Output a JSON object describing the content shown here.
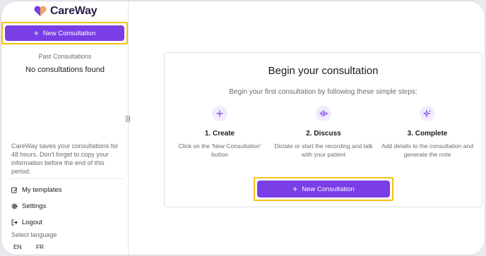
{
  "brand": {
    "name": "CareWay",
    "accent": "#7a3ee6",
    "highlight": "#f2c21b"
  },
  "sidebar": {
    "new_button": {
      "label": "New Consultation",
      "icon": "plus-icon"
    },
    "past_title": "Past Consultations",
    "empty_text": "No consultations found",
    "saves_info": "CareWay saves your consultations for 48 hours. Don't forget to copy your information before the end of this period.",
    "links": [
      {
        "label": "My templates",
        "icon": "template-edit-icon"
      },
      {
        "label": "Settings",
        "icon": "gear-icon"
      },
      {
        "label": "Logout",
        "icon": "logout-icon"
      }
    ],
    "language_label": "Select language",
    "languages": [
      "EN",
      "FR"
    ]
  },
  "main": {
    "title": "Begin your consultation",
    "subtitle": "Begin your first consultation by following these simple steps:",
    "steps": [
      {
        "title": "1. Create",
        "desc": "Click on the 'New Consultation' button",
        "icon": "plus-icon"
      },
      {
        "title": "2. Discuss",
        "desc": "Dictate or start the recording and talk with your patient",
        "icon": "audio-wave-icon"
      },
      {
        "title": "3. Complete",
        "desc": "Add details to the consultation and generate the note",
        "icon": "sparkle-icon"
      }
    ],
    "button": {
      "label": "New Consultation",
      "icon": "plus-icon"
    }
  }
}
